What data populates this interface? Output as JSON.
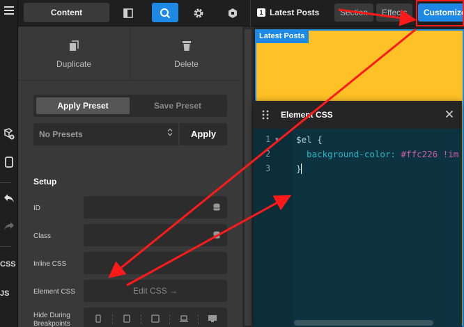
{
  "rail": {
    "css_label": "CSS",
    "js_label": "JS"
  },
  "toolbar": {
    "content_label": "Content",
    "icons": [
      "panel-toggle-icon",
      "search-icon",
      "gear-icon",
      "hexagon-icon"
    ]
  },
  "breadcrumb": {
    "index": "1",
    "label": "Latest Posts"
  },
  "tabs": [
    {
      "label": "Section"
    },
    {
      "label": "Effects"
    },
    {
      "label": "Customize"
    }
  ],
  "actions": {
    "duplicate_label": "Duplicate",
    "delete_label": "Delete"
  },
  "presets": {
    "apply_tab": "Apply Preset",
    "save_tab": "Save Preset",
    "select_value": "No Presets",
    "apply_button": "Apply"
  },
  "setup": {
    "title": "Setup",
    "id_label": "ID",
    "class_label": "Class",
    "inline_css_label": "Inline CSS",
    "element_css_label": "Element CSS",
    "edit_css_button": "Edit CSS →",
    "hide_label_1": "Hide During",
    "hide_label_2": "Breakpoints"
  },
  "canvas": {
    "block_tag": "Latest Posts",
    "block_color": "#ffc226",
    "accent": "#1e88e5"
  },
  "css_editor": {
    "title": "Element CSS",
    "lines": [
      "1",
      "2",
      "3"
    ],
    "line1_selector": "$el {",
    "line2_property": "  background-color:",
    "line2_value": " #ffc226 !im",
    "line3_close": "}"
  },
  "annotation": {
    "arrow_color": "#ff1a1a"
  }
}
